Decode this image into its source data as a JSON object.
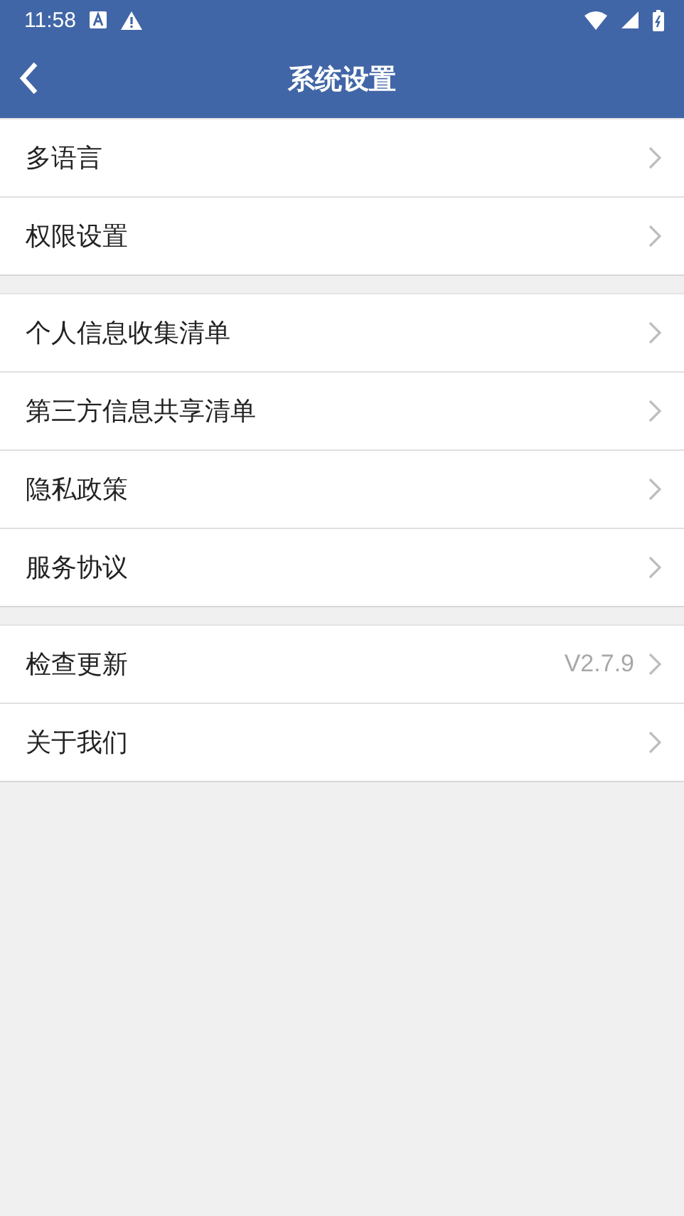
{
  "status_bar": {
    "time": "11:58"
  },
  "header": {
    "title": "系统设置"
  },
  "groups": [
    {
      "items": [
        {
          "label": "多语言"
        },
        {
          "label": "权限设置"
        }
      ]
    },
    {
      "items": [
        {
          "label": "个人信息收集清单"
        },
        {
          "label": "第三方信息共享清单"
        },
        {
          "label": "隐私政策"
        },
        {
          "label": "服务协议"
        }
      ]
    },
    {
      "items": [
        {
          "label": "检查更新",
          "value": "V2.7.9"
        },
        {
          "label": "关于我们"
        }
      ]
    }
  ]
}
